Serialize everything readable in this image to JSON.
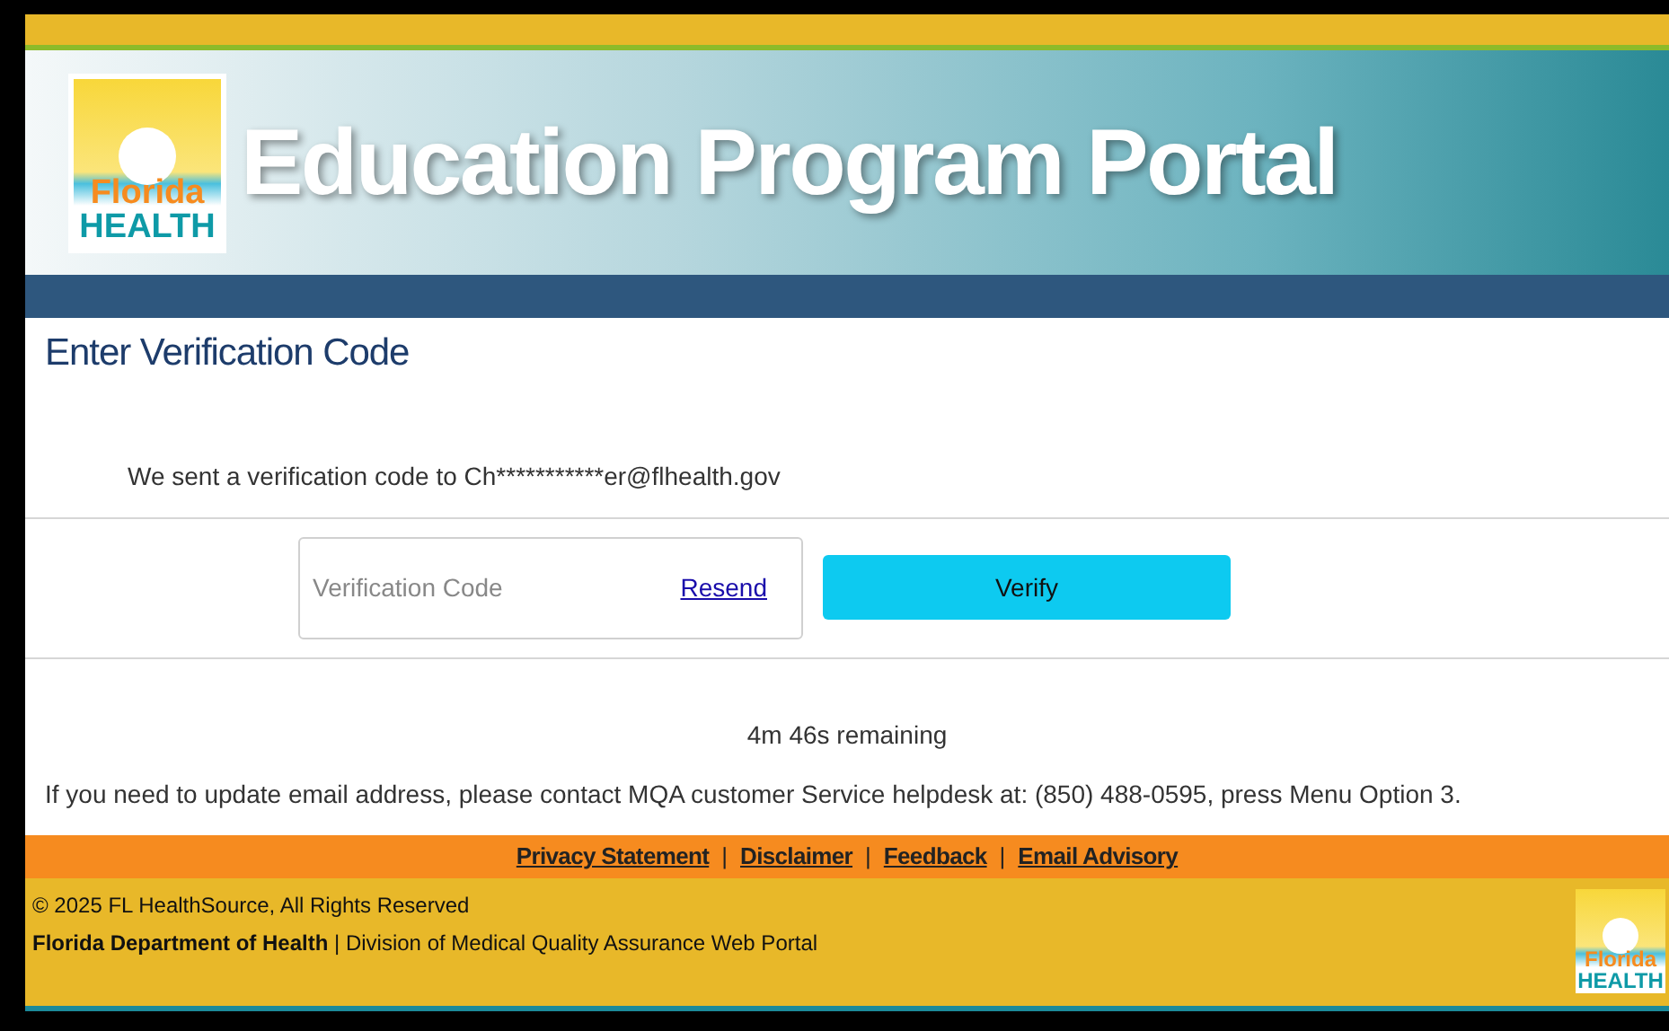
{
  "logo": {
    "line1": "Florida",
    "line2": "HEALTH"
  },
  "banner": {
    "title": "Education Program Portal"
  },
  "page": {
    "heading": "Enter Verification Code",
    "message": "We sent a verification code to Ch***********er@flhealth.gov"
  },
  "form": {
    "code_field": {
      "placeholder": "Verification Code"
    },
    "resend_link": "Resend",
    "verify_button": "Verify"
  },
  "timer": "4m 46s remaining",
  "help_text": "If you need to update email address, please contact MQA customer Service helpdesk at: (850) 488-0595, press Menu Option 3.",
  "footer": {
    "links": [
      "Privacy Statement",
      "Disclaimer",
      "Feedback",
      "Email Advisory"
    ],
    "separator": "|",
    "copyright": "© 2025 FL HealthSource, All Rights Reserved",
    "org_line": "**Florida Department of Health** | Division of Medical Quality Assurance Web Portal",
    "logo": {
      "line1": "Florida",
      "line2": "HEALTH"
    }
  }
}
